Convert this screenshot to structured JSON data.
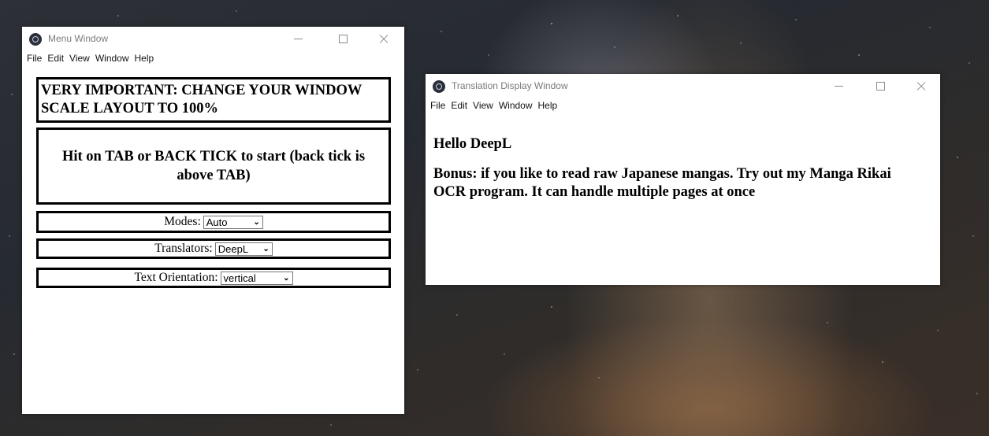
{
  "menu_window": {
    "title": "Menu Window",
    "menu": [
      "File",
      "Edit",
      "View",
      "Window",
      "Help"
    ],
    "warning": "VERY IMPORTANT: CHANGE YOUR WINDOW SCALE LAYOUT TO 100%",
    "instruction": "Hit on TAB or BACK TICK to start (back tick is above TAB)",
    "modes": {
      "label": "Modes:",
      "value": "Auto"
    },
    "translators": {
      "label": "Translators:",
      "value": "DeepL"
    },
    "orientation": {
      "label": "Text Orientation:",
      "value": "vertical"
    }
  },
  "translation_window": {
    "title": "Translation Display Window",
    "menu": [
      "File",
      "Edit",
      "View",
      "Window",
      "Help"
    ],
    "greeting": "Hello DeepL",
    "bonus": "Bonus: if you like to read raw Japanese mangas. Try out my Manga Rikai OCR program. It can handle multiple pages at once"
  },
  "icons": {
    "app": "electron-app-icon",
    "minimize": "minimize-icon",
    "maximize": "maximize-icon",
    "close": "close-icon",
    "dropdown": "chevron-down-icon"
  }
}
